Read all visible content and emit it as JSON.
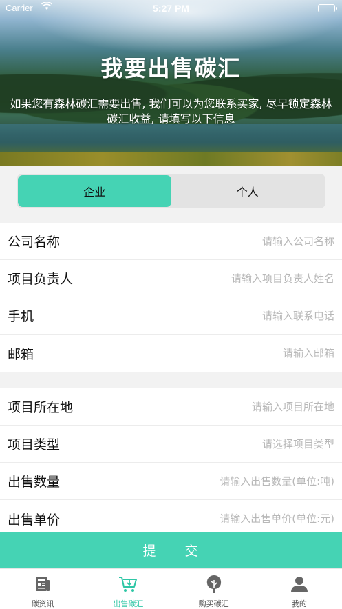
{
  "status_bar": {
    "carrier": "Carrier",
    "time": "5:27 PM"
  },
  "hero": {
    "title": "我要出售碳汇",
    "description": "如果您有森林碳汇需要出售, 我们可以为您联系买家, 尽早锁定森林碳汇收益, 请填写以下信息"
  },
  "segmented": {
    "options": [
      "企业",
      "个人"
    ],
    "selected": "企业"
  },
  "form_group_1": [
    {
      "label": "公司名称",
      "placeholder": "请输入公司名称"
    },
    {
      "label": "项目负责人",
      "placeholder": "请输入项目负责人姓名"
    },
    {
      "label": "手机",
      "placeholder": "请输入联系电话"
    },
    {
      "label": "邮箱",
      "placeholder": "请输入邮箱"
    }
  ],
  "form_group_2": [
    {
      "label": "项目所在地",
      "placeholder": "请输入项目所在地"
    },
    {
      "label": "项目类型",
      "placeholder": "请选择项目类型"
    },
    {
      "label": "出售数量",
      "placeholder": "请输入出售数量(单位:吨)"
    },
    {
      "label": "出售单价",
      "placeholder": "请输入出售单价(单位:元)"
    }
  ],
  "submit": {
    "chars": [
      "提",
      "交"
    ]
  },
  "tabbar": {
    "items": [
      {
        "label": "碳资讯",
        "icon": "news-icon"
      },
      {
        "label": "出售碳汇",
        "icon": "cart-download-icon"
      },
      {
        "label": "购买碳汇",
        "icon": "tree-icon"
      },
      {
        "label": "我的",
        "icon": "person-icon"
      }
    ],
    "active": "出售碳汇"
  },
  "colors": {
    "accent": "#45d3b4",
    "tab_active": "#2fc7a6"
  }
}
